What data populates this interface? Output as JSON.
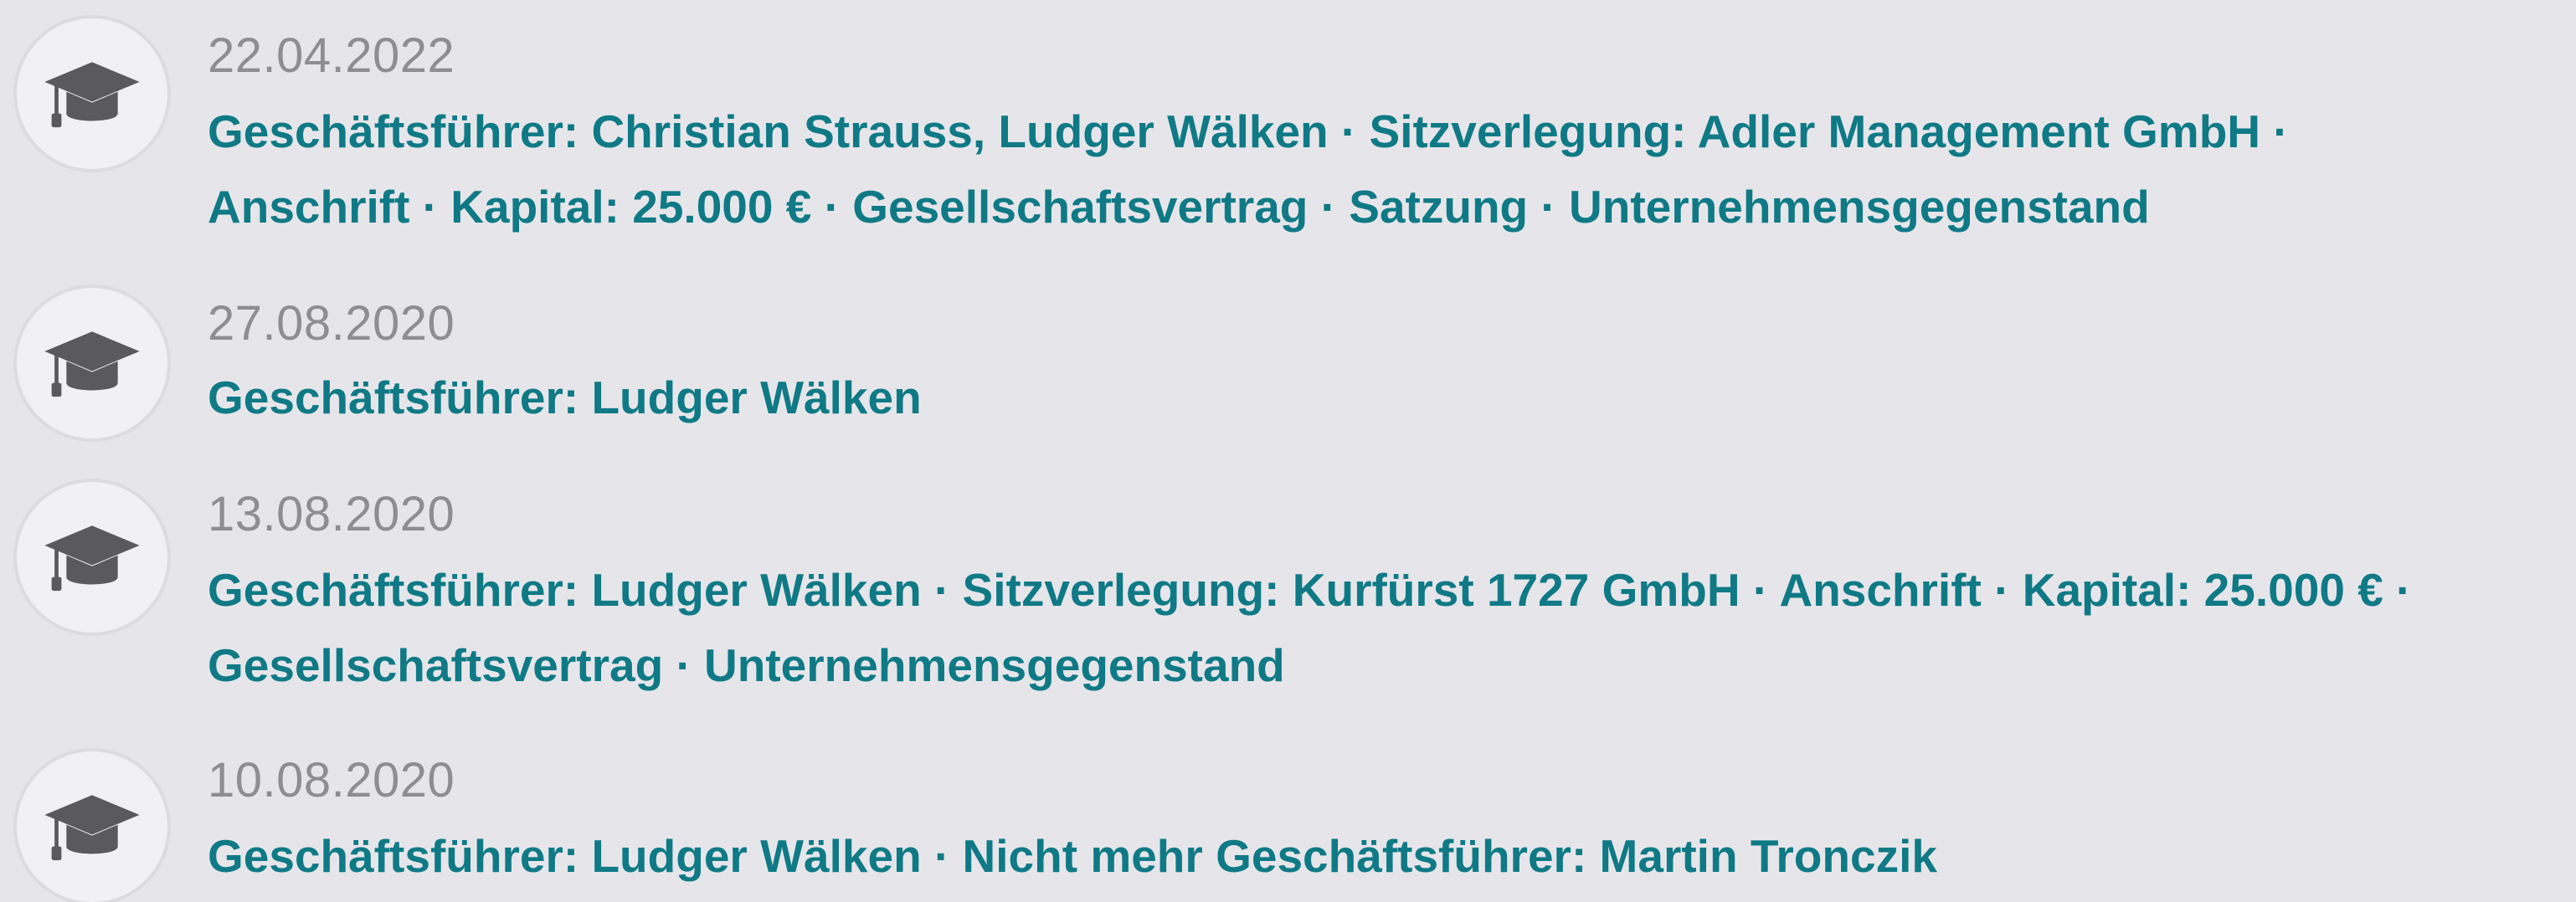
{
  "entries": [
    {
      "date": "22.04.2022",
      "line1": "Geschäftsführer: Christian Strauss, Ludger Wälken · Sitzverlegung: Adler Management GmbH ·",
      "line2": "Anschrift · Kapital: 25.000 € · Gesellschaftsvertrag · Satzung · Unternehmensgegenstand",
      "icon": "graduation-cap-icon"
    },
    {
      "date": "27.08.2020",
      "line1": "Geschäftsführer: Ludger Wälken",
      "line2": "",
      "icon": "graduation-cap-icon"
    },
    {
      "date": "13.08.2020",
      "line1": "Geschäftsführer: Ludger Wälken · Sitzverlegung: Kurfürst 1727 GmbH · Anschrift · Kapital: 25.000 € ·",
      "line2": "Gesellschaftsvertrag · Unternehmensgegenstand",
      "icon": "graduation-cap-icon"
    },
    {
      "date": "10.08.2020",
      "line1": "Geschäftsführer: Ludger Wälken · Nicht mehr Geschäftsführer: Martin Tronczik",
      "line2": "",
      "icon": "graduation-cap-icon"
    }
  ],
  "colors": {
    "background": "#e6e6ea",
    "date_text": "#8e8e92",
    "link_text": "#0f7a86",
    "icon": "#5a5a5e"
  }
}
